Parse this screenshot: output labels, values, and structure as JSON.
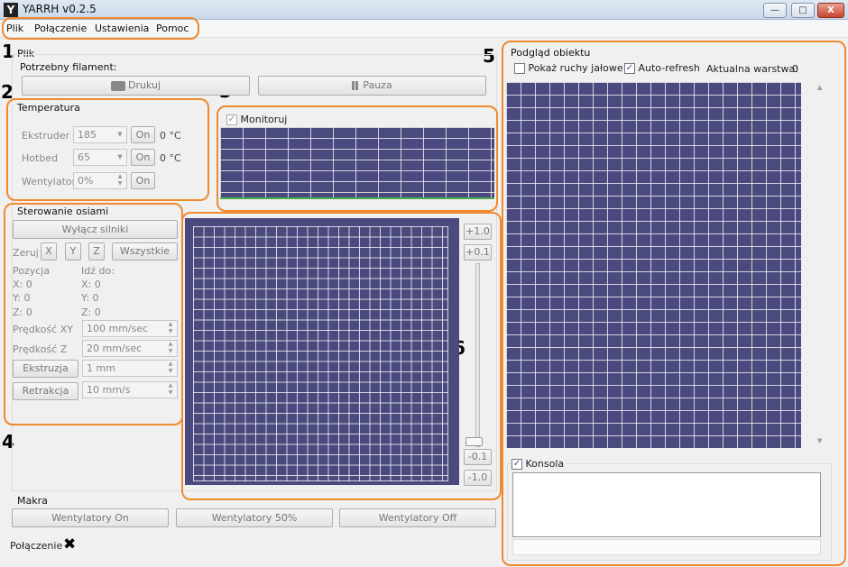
{
  "window": {
    "title": "YARRH v0.2.5",
    "logo": "Y",
    "min": "—",
    "max": "□",
    "close": "X"
  },
  "menu": [
    "Plik",
    "Połączenie",
    "Ustawienia",
    "Pomoc"
  ],
  "markers": [
    "1",
    "2",
    "3",
    "4",
    "5",
    "6"
  ],
  "plik": {
    "group": "Plik",
    "filament_label": "Potrzebny filament:",
    "print": "Drukuj",
    "pause": "Pauza"
  },
  "temperatura": {
    "group": "Temperatura",
    "rows": [
      {
        "label": "Ekstruder",
        "value": "185",
        "btn": "On",
        "reading": "0 °C"
      },
      {
        "label": "Hotbed",
        "value": "65",
        "btn": "On",
        "reading": "0 °C"
      },
      {
        "label": "Wentylator",
        "value": "0%",
        "btn": "On",
        "reading": ""
      }
    ]
  },
  "monitor": {
    "label": "Monitoruj",
    "checked": true
  },
  "axes": {
    "group": "Sterowanie osiami",
    "disable_motors": "Wyłącz silniki",
    "home_label": "Zeruj",
    "home_x": "X",
    "home_y": "Y",
    "home_z": "Z",
    "home_all": "Wszystkie",
    "position_label": "Pozycja",
    "goto_label": "Idź do:",
    "pos": [
      "X: 0",
      "Y: 0",
      "Z: 0"
    ],
    "goto": [
      "X: 0",
      "Y: 0",
      "Z: 0"
    ],
    "speed_xy_label": "Prędkość XY",
    "speed_xy": "100 mm/sec",
    "speed_z_label": "Prędkość Z",
    "speed_z": "20 mm/sec",
    "extrude_btn": "Ekstruzja",
    "extrude": "1 mm",
    "retract_btn": "Retrakcja",
    "retract": "10 mm/s"
  },
  "z_control": {
    "up1": "+1.0",
    "up01": "+0.1",
    "down01": "-0.1",
    "down1": "-1.0"
  },
  "preview": {
    "group": "Podgląd obiektu",
    "show_travel": "Pokaż ruchy jałowe",
    "show_travel_checked": false,
    "auto_refresh": "Auto-refresh",
    "auto_refresh_checked": true,
    "layer_label": "Aktualna warstwa:",
    "layer_value": "0"
  },
  "console": {
    "label": "Konsola",
    "checked": true
  },
  "macros": {
    "group": "Makra",
    "buttons": [
      "Wentylatory On",
      "Wentylatory 50%",
      "Wentylatory Off"
    ]
  },
  "status": {
    "label": "Połączenie",
    "icon": "✖"
  },
  "colors": {
    "accent": "#ef8a2f",
    "grid_bg": "#4b4a7e"
  }
}
